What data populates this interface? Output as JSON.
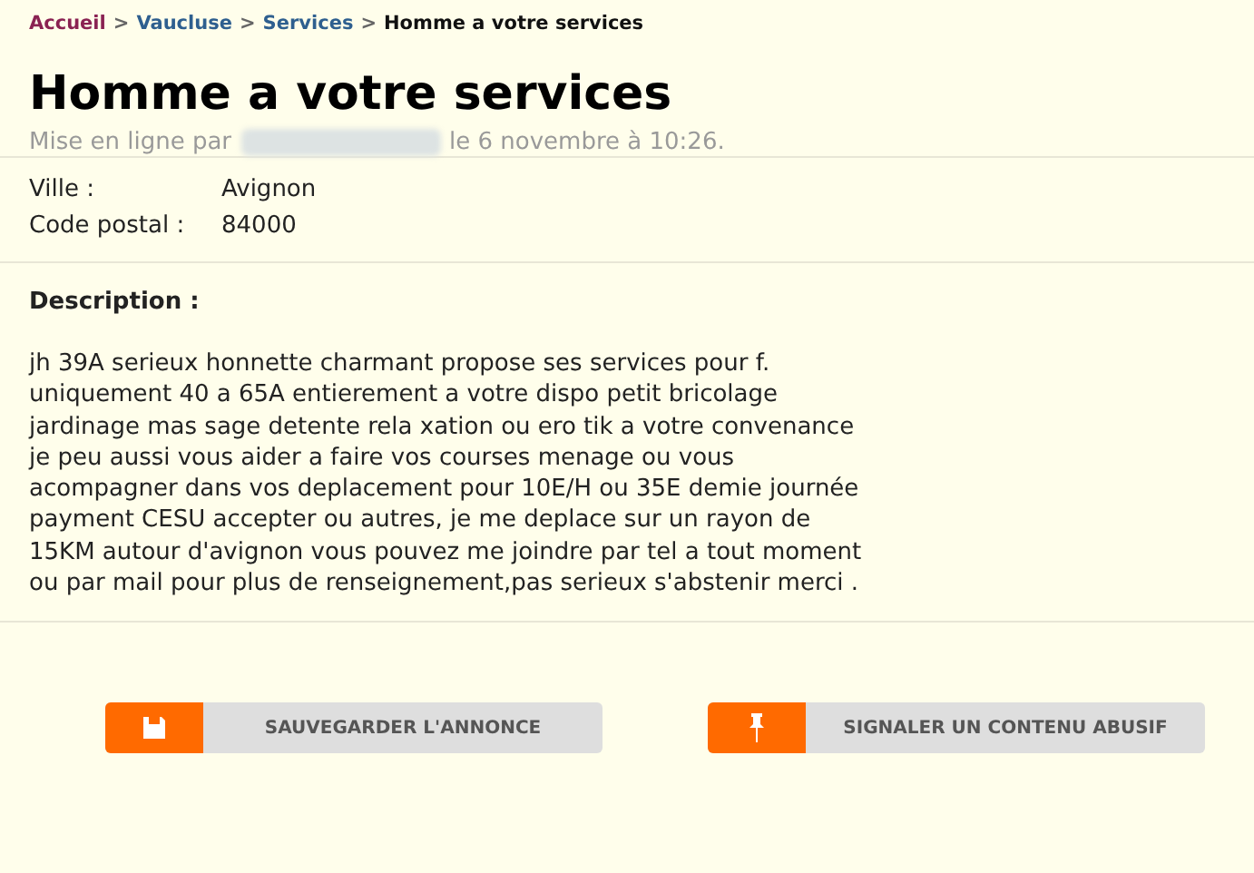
{
  "breadcrumb": [
    {
      "label": "Accueil",
      "kind": "home"
    },
    {
      "label": "Vaucluse",
      "kind": "link"
    },
    {
      "label": "Services",
      "kind": "link"
    },
    {
      "label": "Homme a votre services",
      "kind": "current"
    }
  ],
  "separator": ">",
  "title": "Homme a votre services",
  "posted": {
    "prefix": "Mise en ligne par",
    "suffix": "le 6 novembre à 10:26."
  },
  "details": [
    {
      "label": "Ville :",
      "value": "Avignon"
    },
    {
      "label": "Code postal :",
      "value": "84000"
    }
  ],
  "description": {
    "heading": "Description :",
    "text": "jh 39A serieux honnette charmant propose ses services pour f.\nuniquement 40 a 65A entierement a votre dispo petit bricolage\njardinage mas sage detente rela xation ou ero tik a votre convenance\nje peu aussi vous aider a faire vos courses menage ou vous\nacompagner dans vos deplacement pour 10E/H ou 35E demie journée\npayment CESU accepter ou autres, je me deplace sur un rayon de\n15KM autour d'avignon vous pouvez me joindre par tel a tout moment\nou par mail pour plus de renseignement,pas serieux s'abstenir merci ."
  },
  "buttons": [
    {
      "label": "SAUVEGARDER L'ANNONCE",
      "kind": "save"
    },
    {
      "label": "SIGNALER UN CONTENU ABUSIF",
      "kind": "report"
    }
  ]
}
